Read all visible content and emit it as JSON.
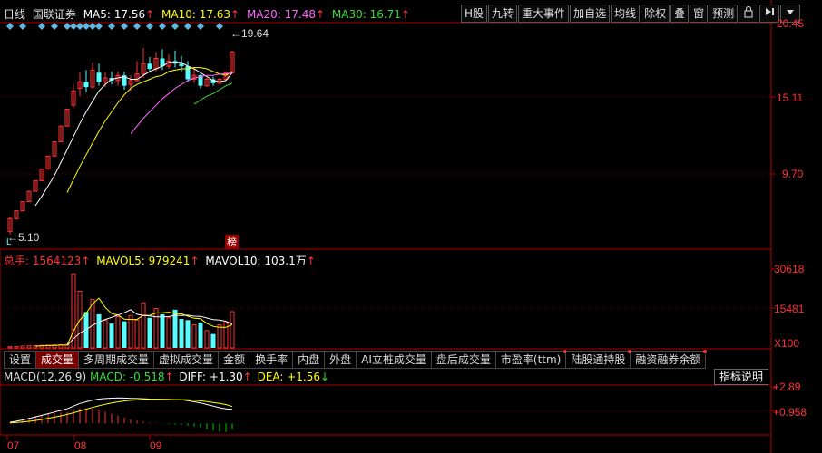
{
  "header": {
    "period": "日线",
    "stock_name": "国联证券",
    "ma": [
      {
        "label": "MA5: 17.56",
        "color": "#ffffff"
      },
      {
        "label": "MA10: 17.63",
        "color": "#ffff00"
      },
      {
        "label": "MA20: 17.48",
        "color": "#ff66ff"
      },
      {
        "label": "MA30: 16.71",
        "color": "#33dd33"
      }
    ],
    "up_arrow": "↑"
  },
  "toolbar": {
    "items": [
      "H股",
      "九转",
      "重大事件",
      "加自选",
      "均线",
      "除权",
      "叠",
      "窗",
      "预测"
    ],
    "lock_icon": "lock-icon",
    "arrow_icon": "skip-right-icon",
    "menu_icon": "caret-down-icon"
  },
  "price_axis": {
    "labels": [
      "20.45",
      "15.11",
      "9.70"
    ]
  },
  "price_annotations": {
    "high": "19.64",
    "low": "5.10",
    "low_marker": "L",
    "badge": "榜"
  },
  "volume_header": {
    "total_label": "总手: 1564123",
    "mavol5_label": "MAVOL5: 979241",
    "mavol10_label": "MAVOL10: 103.1万",
    "up_arrow": "↑"
  },
  "volume_axis": {
    "labels": [
      "30618",
      "15481"
    ],
    "unit": "X100"
  },
  "tabs": {
    "items": [
      "设置",
      "成交量",
      "多周期成交量",
      "虚拟成交量",
      "金额",
      "换手率",
      "内盘",
      "外盘",
      "AI立桩成交量",
      "盘后成交量",
      "市盈率(ttm)",
      "陆股通持股",
      "融资融券余额"
    ],
    "active": "成交量",
    "dotted": [
      "市盈率(ttm)",
      "陆股通持股",
      "融资融券余额"
    ]
  },
  "help_button": "指标说明",
  "macd_header": {
    "name": "MACD(12,26,9)",
    "macd_label": "MACD: -0.518",
    "diff_label": "DIFF: +1.30",
    "dea_label": "DEA: +1.56",
    "up_arrow": "↑",
    "down_arrow": "↓"
  },
  "macd_axis": {
    "labels": [
      "+2.89",
      "+0.958"
    ]
  },
  "date_axis": {
    "labels": [
      "07",
      "08",
      "09"
    ]
  },
  "colors": {
    "up": "#ff3333",
    "down": "#55ffff",
    "macd_neg": "#00cc00",
    "frame": "#b00000"
  },
  "chart_data": {
    "type": "candlestick",
    "candles": [
      {
        "o": 5.3,
        "h": 6.4,
        "l": 5.1,
        "c": 6.3
      },
      {
        "o": 6.3,
        "h": 6.9,
        "l": 6.2,
        "c": 6.9
      },
      {
        "o": 6.9,
        "h": 7.6,
        "l": 6.9,
        "c": 7.6
      },
      {
        "o": 7.6,
        "h": 8.4,
        "l": 7.6,
        "c": 8.4
      },
      {
        "o": 8.4,
        "h": 9.2,
        "l": 8.4,
        "c": 9.2
      },
      {
        "o": 9.2,
        "h": 10.1,
        "l": 9.2,
        "c": 10.1
      },
      {
        "o": 10.1,
        "h": 11.1,
        "l": 10.1,
        "c": 11.1
      },
      {
        "o": 11.1,
        "h": 12.2,
        "l": 11.1,
        "c": 12.2
      },
      {
        "o": 12.2,
        "h": 13.4,
        "l": 12.2,
        "c": 13.4
      },
      {
        "o": 13.4,
        "h": 14.7,
        "l": 13.4,
        "c": 14.7
      },
      {
        "o": 15.0,
        "h": 16.6,
        "l": 14.8,
        "c": 16.1
      },
      {
        "o": 16.3,
        "h": 17.5,
        "l": 15.7,
        "c": 16.8
      },
      {
        "o": 16.8,
        "h": 17.7,
        "l": 16.0,
        "c": 16.4
      },
      {
        "o": 16.4,
        "h": 18.3,
        "l": 16.3,
        "c": 17.7
      },
      {
        "o": 17.5,
        "h": 18.2,
        "l": 16.5,
        "c": 16.8
      },
      {
        "o": 16.8,
        "h": 17.5,
        "l": 16.4,
        "c": 17.1
      },
      {
        "o": 17.1,
        "h": 17.6,
        "l": 16.6,
        "c": 16.9
      },
      {
        "o": 16.9,
        "h": 17.6,
        "l": 16.5,
        "c": 17.3
      },
      {
        "o": 17.3,
        "h": 17.6,
        "l": 16.2,
        "c": 16.5
      },
      {
        "o": 16.6,
        "h": 17.3,
        "l": 16.1,
        "c": 16.9
      },
      {
        "o": 16.9,
        "h": 18.4,
        "l": 16.8,
        "c": 17.4
      },
      {
        "o": 17.4,
        "h": 19.4,
        "l": 17.1,
        "c": 18.2
      },
      {
        "o": 18.2,
        "h": 18.7,
        "l": 17.5,
        "c": 17.8
      },
      {
        "o": 17.8,
        "h": 19.1,
        "l": 17.6,
        "c": 18.6
      },
      {
        "o": 18.6,
        "h": 19.3,
        "l": 17.7,
        "c": 18.0
      },
      {
        "o": 18.0,
        "h": 18.9,
        "l": 17.8,
        "c": 18.4
      },
      {
        "o": 18.4,
        "h": 19.2,
        "l": 17.9,
        "c": 18.2
      },
      {
        "o": 18.2,
        "h": 18.8,
        "l": 17.6,
        "c": 18.0
      },
      {
        "o": 18.0,
        "h": 18.4,
        "l": 16.8,
        "c": 17.0
      },
      {
        "o": 17.0,
        "h": 17.8,
        "l": 16.7,
        "c": 17.3
      },
      {
        "o": 17.3,
        "h": 17.4,
        "l": 16.3,
        "c": 16.5
      },
      {
        "o": 16.5,
        "h": 17.1,
        "l": 16.4,
        "c": 17.0
      },
      {
        "o": 17.0,
        "h": 17.2,
        "l": 16.5,
        "c": 16.7
      },
      {
        "o": 16.7,
        "h": 17.1,
        "l": 16.6,
        "c": 17.0
      },
      {
        "o": 17.0,
        "h": 17.6,
        "l": 16.9,
        "c": 17.5
      },
      {
        "o": 17.5,
        "h": 19.2,
        "l": 17.4,
        "c": 19.1
      }
    ],
    "ma5": [
      null,
      null,
      null,
      null,
      7.3,
      8.0,
      8.8,
      9.6,
      10.6,
      11.6,
      12.6,
      13.6,
      14.5,
      15.3,
      16.1,
      16.6,
      17.0,
      17.1,
      17.2,
      17.0,
      17.0,
      17.3,
      17.6,
      17.8,
      18.0,
      18.3,
      18.3,
      18.3,
      18.0,
      17.8,
      17.5,
      17.2,
      16.9,
      16.8,
      16.9,
      17.5
    ],
    "ma10": [
      null,
      null,
      null,
      null,
      null,
      null,
      null,
      null,
      null,
      8.3,
      9.3,
      10.3,
      11.2,
      12.1,
      13.0,
      13.8,
      14.5,
      15.2,
      15.8,
      16.3,
      16.6,
      16.8,
      17.0,
      17.2,
      17.3,
      17.6,
      17.7,
      17.8,
      17.8,
      17.9,
      17.9,
      17.8,
      17.6,
      17.4,
      17.3,
      17.6
    ],
    "ma20": [
      null,
      null,
      null,
      null,
      null,
      null,
      null,
      null,
      null,
      null,
      null,
      null,
      null,
      null,
      null,
      null,
      null,
      null,
      null,
      12.8,
      13.4,
      14.0,
      14.5,
      15.0,
      15.5,
      15.9,
      16.3,
      16.6,
      16.9,
      17.1,
      17.2,
      17.3,
      17.3,
      17.4,
      17.4,
      17.5
    ],
    "ma30": [
      null,
      null,
      null,
      null,
      null,
      null,
      null,
      null,
      null,
      null,
      null,
      null,
      null,
      null,
      null,
      null,
      null,
      null,
      null,
      null,
      null,
      null,
      null,
      null,
      null,
      null,
      null,
      null,
      null,
      15.1,
      15.4,
      15.7,
      15.9,
      16.2,
      16.5,
      16.7
    ],
    "volume": [
      500,
      600,
      800,
      900,
      1000,
      1100,
      1200,
      1300,
      1400,
      1500,
      32000,
      24500,
      15500,
      21000,
      14500,
      12000,
      10500,
      13500,
      11500,
      14000,
      12000,
      19500,
      13000,
      17000,
      14500,
      13000,
      16500,
      12500,
      12000,
      10000,
      11000,
      7500,
      6000,
      10000,
      11000,
      15641
    ],
    "mavol5": [
      null,
      null,
      null,
      null,
      760,
      880,
      1000,
      1100,
      1200,
      1300,
      7300,
      12100,
      15000,
      19000,
      21500,
      17500,
      14800,
      14200,
      12400,
      12300,
      12300,
      14100,
      14000,
      15100,
      15200,
      15400,
      14800,
      14700,
      13700,
      12800,
      12600,
      10600,
      9300,
      8900,
      8900,
      10000
    ],
    "mavol10": [
      null,
      null,
      null,
      null,
      null,
      null,
      null,
      null,
      null,
      1030,
      4000,
      6400,
      7900,
      9800,
      11200,
      12300,
      13200,
      14200,
      15200,
      16500,
      14500,
      14000,
      13800,
      13400,
      13400,
      13500,
      14100,
      14000,
      14100,
      13700,
      13600,
      12900,
      12200,
      12000,
      11500,
      10300
    ],
    "macd_dif": [
      0.1,
      0.2,
      0.32,
      0.45,
      0.6,
      0.75,
      0.9,
      1.05,
      1.2,
      1.35,
      1.6,
      1.85,
      2.0,
      2.15,
      2.25,
      2.3,
      2.33,
      2.35,
      2.34,
      2.32,
      2.3,
      2.28,
      2.25,
      2.24,
      2.23,
      2.22,
      2.2,
      2.18,
      2.1,
      2.0,
      1.9,
      1.75,
      1.6,
      1.45,
      1.35,
      1.3
    ],
    "macd_dea": [
      0.05,
      0.08,
      0.13,
      0.19,
      0.27,
      0.36,
      0.47,
      0.58,
      0.7,
      0.83,
      0.98,
      1.15,
      1.32,
      1.48,
      1.63,
      1.77,
      1.89,
      1.99,
      2.07,
      2.13,
      2.17,
      2.2,
      2.21,
      2.22,
      2.22,
      2.22,
      2.21,
      2.2,
      2.18,
      2.14,
      2.09,
      2.02,
      1.94,
      1.85,
      1.75,
      1.56
    ],
    "macd_hist": [
      0.1,
      0.24,
      0.38,
      0.52,
      0.66,
      0.78,
      0.86,
      0.94,
      1.0,
      1.04,
      1.24,
      1.4,
      1.36,
      1.34,
      1.24,
      1.06,
      0.88,
      0.72,
      0.54,
      0.38,
      0.26,
      0.16,
      0.08,
      0.04,
      -0.02,
      -0.06,
      -0.1,
      -0.12,
      -0.2,
      -0.28,
      -0.38,
      -0.54,
      -0.68,
      -0.8,
      -0.8,
      -0.518
    ],
    "price_range": [
      4.3,
      21.0
    ],
    "volume_range": [
      0,
      36000
    ],
    "macd_range": [
      -0.9,
      3.3
    ]
  }
}
